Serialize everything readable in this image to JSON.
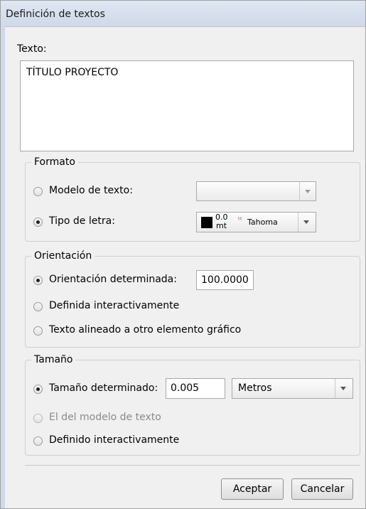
{
  "window": {
    "title": "Definición de textos"
  },
  "texto": {
    "label": "Texto:",
    "value": "TÍTULO PROYECTO"
  },
  "formato": {
    "legend": "Formato",
    "modelo_label": "Modelo de texto:",
    "modelo_value": "",
    "tipo_label": "Tipo de letra:",
    "font_color": "#000000",
    "font_size_top": "0.0",
    "font_size_unit": "mt",
    "font_name": "Tahoma",
    "selected": "tipo"
  },
  "orientacion": {
    "legend": "Orientación",
    "determinada_label": "Orientación determinada:",
    "determinada_value": "100.0000",
    "interactiva_label": "Definida interactivamente",
    "alineado_label": "Texto alineado a otro elemento gráfico",
    "selected": "determinada"
  },
  "tamano": {
    "legend": "Tamaño",
    "determinado_label": "Tamaño determinado:",
    "determinado_value": "0.005",
    "units_value": "Metros",
    "modelo_label": "El del modelo de texto",
    "interactivo_label": "Definido interactivamente",
    "selected": "determinado"
  },
  "buttons": {
    "ok": "Aceptar",
    "cancel": "Cancelar"
  }
}
